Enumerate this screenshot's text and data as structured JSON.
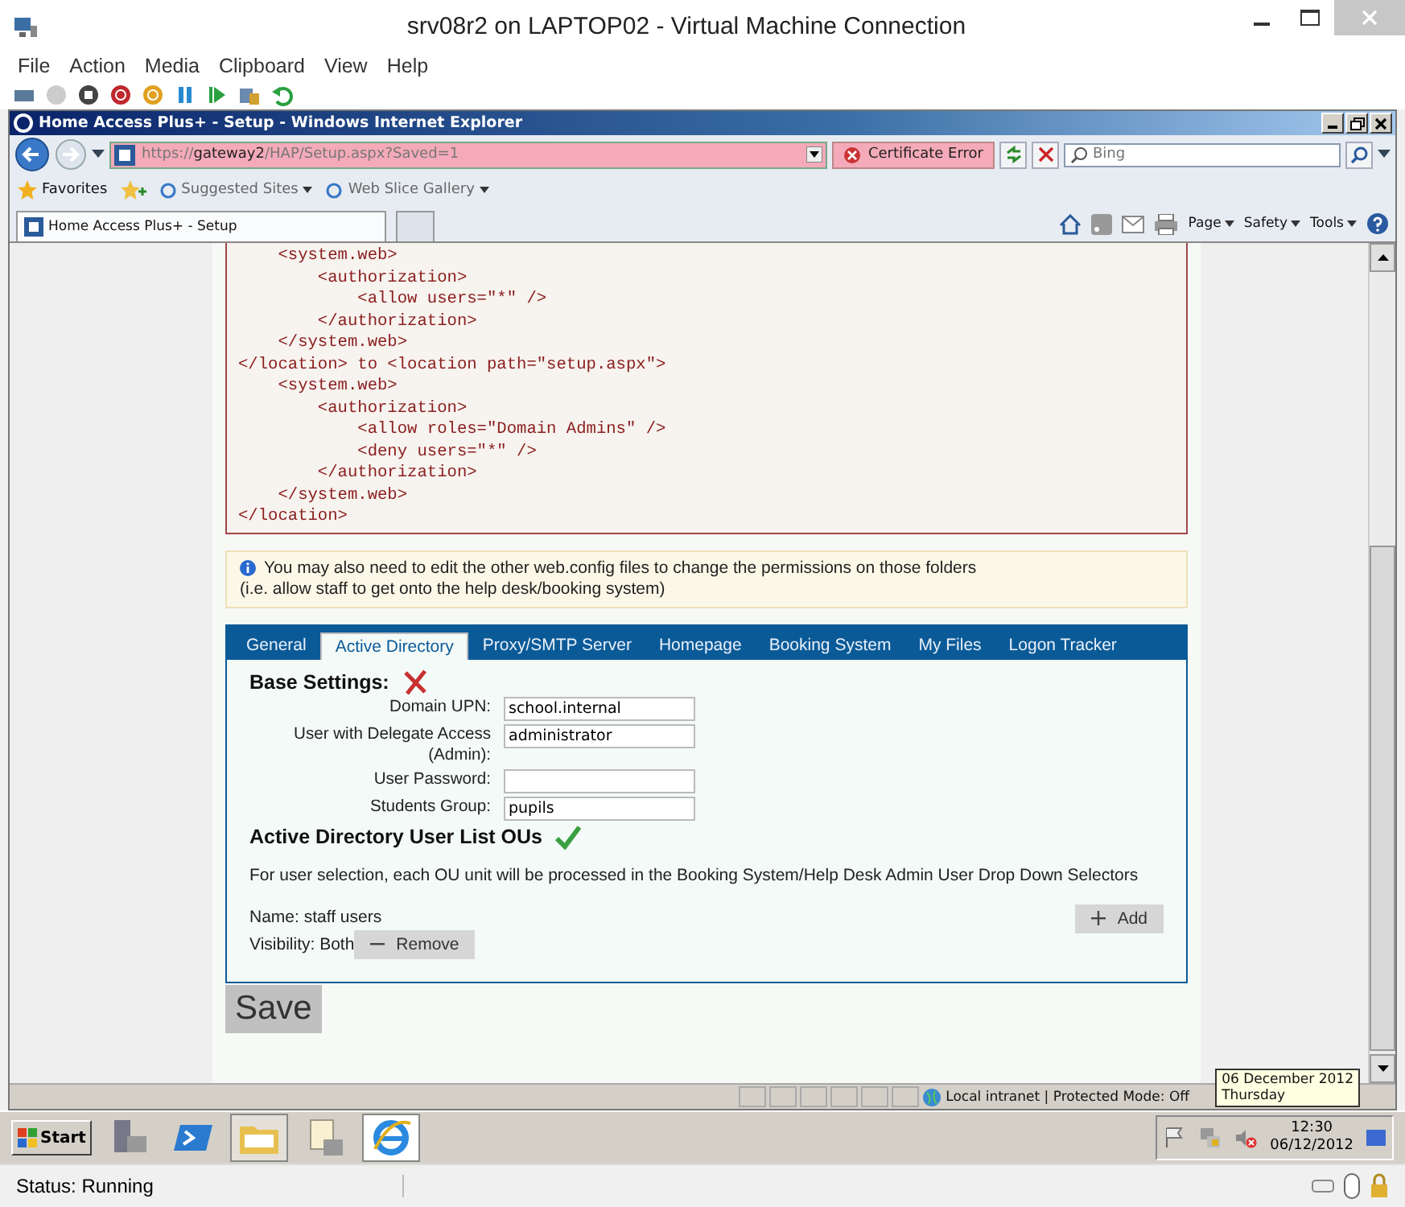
{
  "vm_window": {
    "title": "srv08r2 on LAPTOP02 - Virtual Machine Connection",
    "menu": [
      "File",
      "Action",
      "Media",
      "Clipboard",
      "View",
      "Help"
    ],
    "status": "Status: Running"
  },
  "browser": {
    "title": "Home Access Plus+ - Setup - Windows Internet Explorer",
    "address": {
      "scheme": "https://",
      "host": "gateway2",
      "path": "/HAP/Setup.aspx?Saved=1"
    },
    "certificate_error": "Certificate Error",
    "search": {
      "placeholder": "Bing"
    },
    "favorites": {
      "label": "Favorites",
      "links": [
        "Suggested Sites",
        "Web Slice Gallery"
      ]
    },
    "tabs": [
      {
        "label": "Home Access Plus+ - Setup",
        "selected": true
      }
    ],
    "command_bar": [
      "Page",
      "Safety",
      "Tools"
    ],
    "status_bar": {
      "zone": "Local intranet | Protected Mode: Off"
    }
  },
  "page": {
    "code_lines": [
      "    <system.web>",
      "        <authorization>",
      "            <allow users=\"*\" />",
      "        </authorization>",
      "    </system.web>",
      "</location> to <location path=\"setup.aspx\">",
      "    <system.web>",
      "        <authorization>",
      "            <allow roles=\"Domain Admins\" />",
      "            <deny users=\"*\" />",
      "        </authorization>",
      "    </system.web>",
      "</location>"
    ],
    "info_note": [
      "You may also need to edit the other web.config files to change the permissions on those folders",
      "(i.e. allow staff to get onto the help desk/booking system)"
    ],
    "settings_tabs": [
      {
        "label": "General",
        "selected": false
      },
      {
        "label": "Active Directory",
        "selected": true
      },
      {
        "label": "Proxy/SMTP Server",
        "selected": false
      },
      {
        "label": "Homepage",
        "selected": false
      },
      {
        "label": "Booking System",
        "selected": false
      },
      {
        "label": "My Files",
        "selected": false
      },
      {
        "label": "Logon Tracker",
        "selected": false
      }
    ],
    "base_settings": {
      "title": "Base Settings:",
      "valid": false
    },
    "fields": [
      {
        "label": "Domain UPN:",
        "value": "school.internal"
      },
      {
        "label": "User with Delegate Access (Admin):",
        "value": "administrator"
      },
      {
        "label": "User Password:"
      },
      {
        "label": "Students Group:",
        "value": "pupils"
      }
    ],
    "ou_section": {
      "title": "Active Directory User List OUs",
      "valid": true,
      "description": "For user selection, each OU unit will be processed in the Booking System/Help Desk Admin User Drop Down Selectors",
      "name": "Name: staff users",
      "visibility": "Visibility: Both",
      "remove_button": "Remove",
      "add_button": "Add"
    },
    "save_button": "Save"
  },
  "taskbar": {
    "start": "Start",
    "time": "12:30",
    "date": "06/12/2012",
    "tooltip": [
      "06 December 2012",
      "Thursday"
    ]
  }
}
